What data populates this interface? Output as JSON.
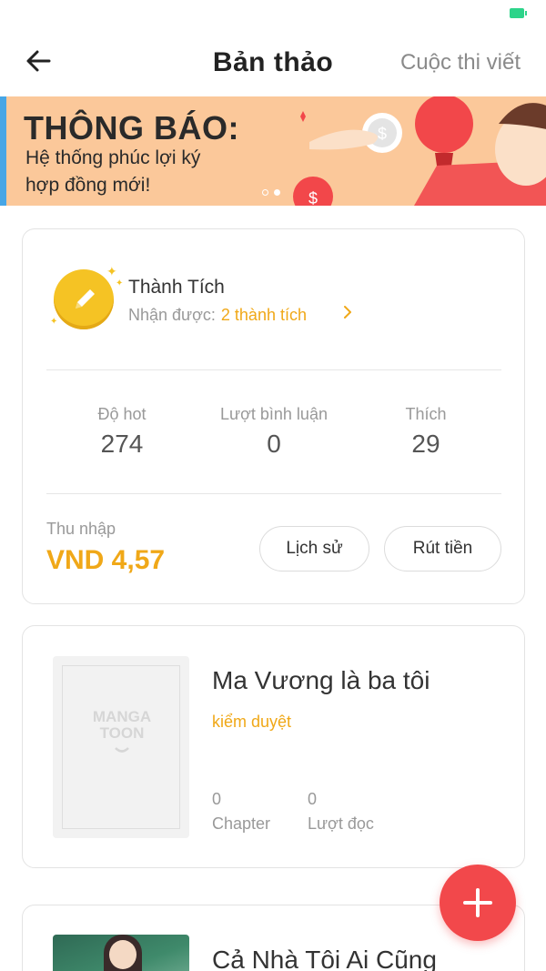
{
  "header": {
    "title": "Bản thảo",
    "contest_link": "Cuộc thi viết"
  },
  "banner": {
    "title": "THÔNG BÁO:",
    "line1": "Hệ thống phúc lợi ký",
    "line2": "hợp đồng mới!",
    "page_count": 2,
    "active_page": 2
  },
  "achievements": {
    "title": "Thành Tích",
    "received_label": "Nhận được:",
    "received_value": "2 thành tích"
  },
  "stats": [
    {
      "label": "Độ hot",
      "value": "274"
    },
    {
      "label": "Lượt bình luận",
      "value": "0"
    },
    {
      "label": "Thích",
      "value": "29"
    }
  ],
  "income": {
    "label": "Thu nhập",
    "value": "VND 4,57"
  },
  "buttons": {
    "history": "Lịch sử",
    "withdraw": "Rút tiền"
  },
  "books": [
    {
      "title": "Ma Vương là ba tôi",
      "status": "kiểm duyệt",
      "cover_text_line1": "MANGA",
      "cover_text_line2": "TOON",
      "chapters": "0",
      "chapters_label": "Chapter",
      "reads": "0",
      "reads_label": "Lượt đọc"
    },
    {
      "title": "Cả Nhà Tôi Ai Cũng"
    }
  ],
  "colors": {
    "accent": "#f0a818",
    "fab": "#f2484b",
    "banner_bg": "#fbc89a",
    "banner_stripe": "#47a6e6"
  },
  "icons": {
    "back": "arrow-left-icon",
    "chevron": "chevron-right-icon",
    "medal": "pencil-medal-icon",
    "fab": "plus-icon"
  }
}
